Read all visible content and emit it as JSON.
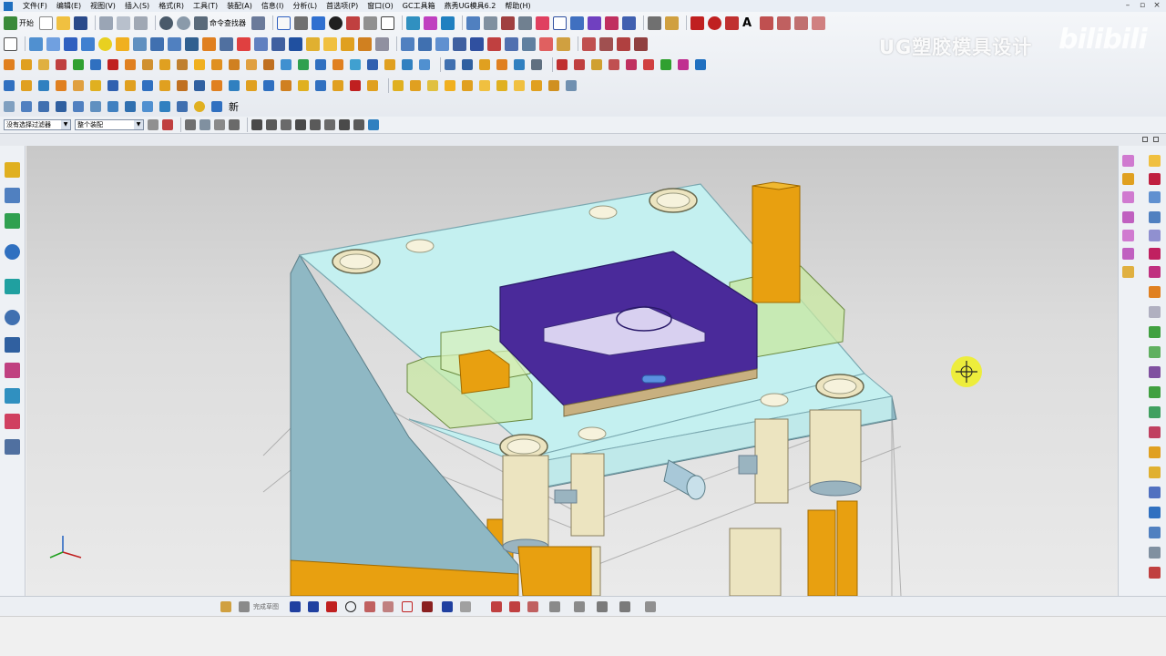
{
  "menu": {
    "items": [
      "文件(F)",
      "编辑(E)",
      "视图(V)",
      "插入(S)",
      "格式(R)",
      "工具(T)",
      "装配(A)",
      "信息(I)",
      "分析(L)",
      "首选项(P)",
      "窗口(O)",
      "GC工具箱",
      "燕秀UG模具6.2",
      "帮助(H)"
    ]
  },
  "toolbar": {
    "start_label": "开始",
    "command_finder_label": "命令查找器"
  },
  "selection": {
    "filter": "没有选择过滤器",
    "scope": "整个装配"
  },
  "watermark": {
    "title": "UG塑胶模具设计",
    "logo": "bilibili"
  },
  "bottom": {
    "sketch_label": "完成草图"
  },
  "toolbar_misc": {
    "new_label": "新"
  },
  "colors": {
    "plate": "#c4f0f0",
    "plate_side": "#8fb8c4",
    "cavity_insert": "#4a2a9a",
    "pin": "#e8a010",
    "guide_bushing": "#ece4c0"
  }
}
